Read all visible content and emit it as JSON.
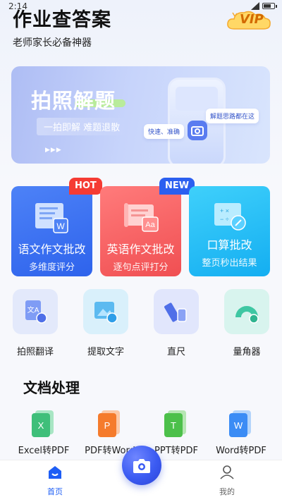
{
  "status": {
    "time": "2:14"
  },
  "header": {
    "title": "作业查答案",
    "subtitle": "老师家长必备神器",
    "vip_label": "VIP"
  },
  "banner": {
    "title": "拍照解题",
    "tagline": "一拍即解 难题退散",
    "bubble_top": "解题思路都在这",
    "bubble_left": "快速、准确"
  },
  "feature_cards": [
    {
      "name": "语文作文批改",
      "desc": "多维度评分",
      "badge": "HOT"
    },
    {
      "name": "英语作文批改",
      "desc": "逐句点评打分",
      "badge": "NEW"
    },
    {
      "name": "口算批改",
      "desc": "整页秒出结果"
    }
  ],
  "tools": [
    {
      "label": "拍照翻译"
    },
    {
      "label": "提取文字"
    },
    {
      "label": "直尺"
    },
    {
      "label": "量角器"
    }
  ],
  "docs": {
    "title": "文档处理",
    "items": [
      {
        "label": "Excel转PDF",
        "icon_letter": "X",
        "color": "#3fbf7a"
      },
      {
        "label": "PDF转Word",
        "icon_letter": "P",
        "color": "#f57b2c"
      },
      {
        "label": "PPT转PDF",
        "icon_letter": "T",
        "color": "#4cc04a"
      },
      {
        "label": "Word转PDF",
        "icon_letter": "W",
        "color": "#3b8cf5"
      }
    ]
  },
  "tabbar": {
    "home": "首页",
    "mine": "我的"
  },
  "colors": {
    "accent": "#1e5ef5",
    "hot": "#f53b33",
    "new": "#2b5ff0"
  }
}
